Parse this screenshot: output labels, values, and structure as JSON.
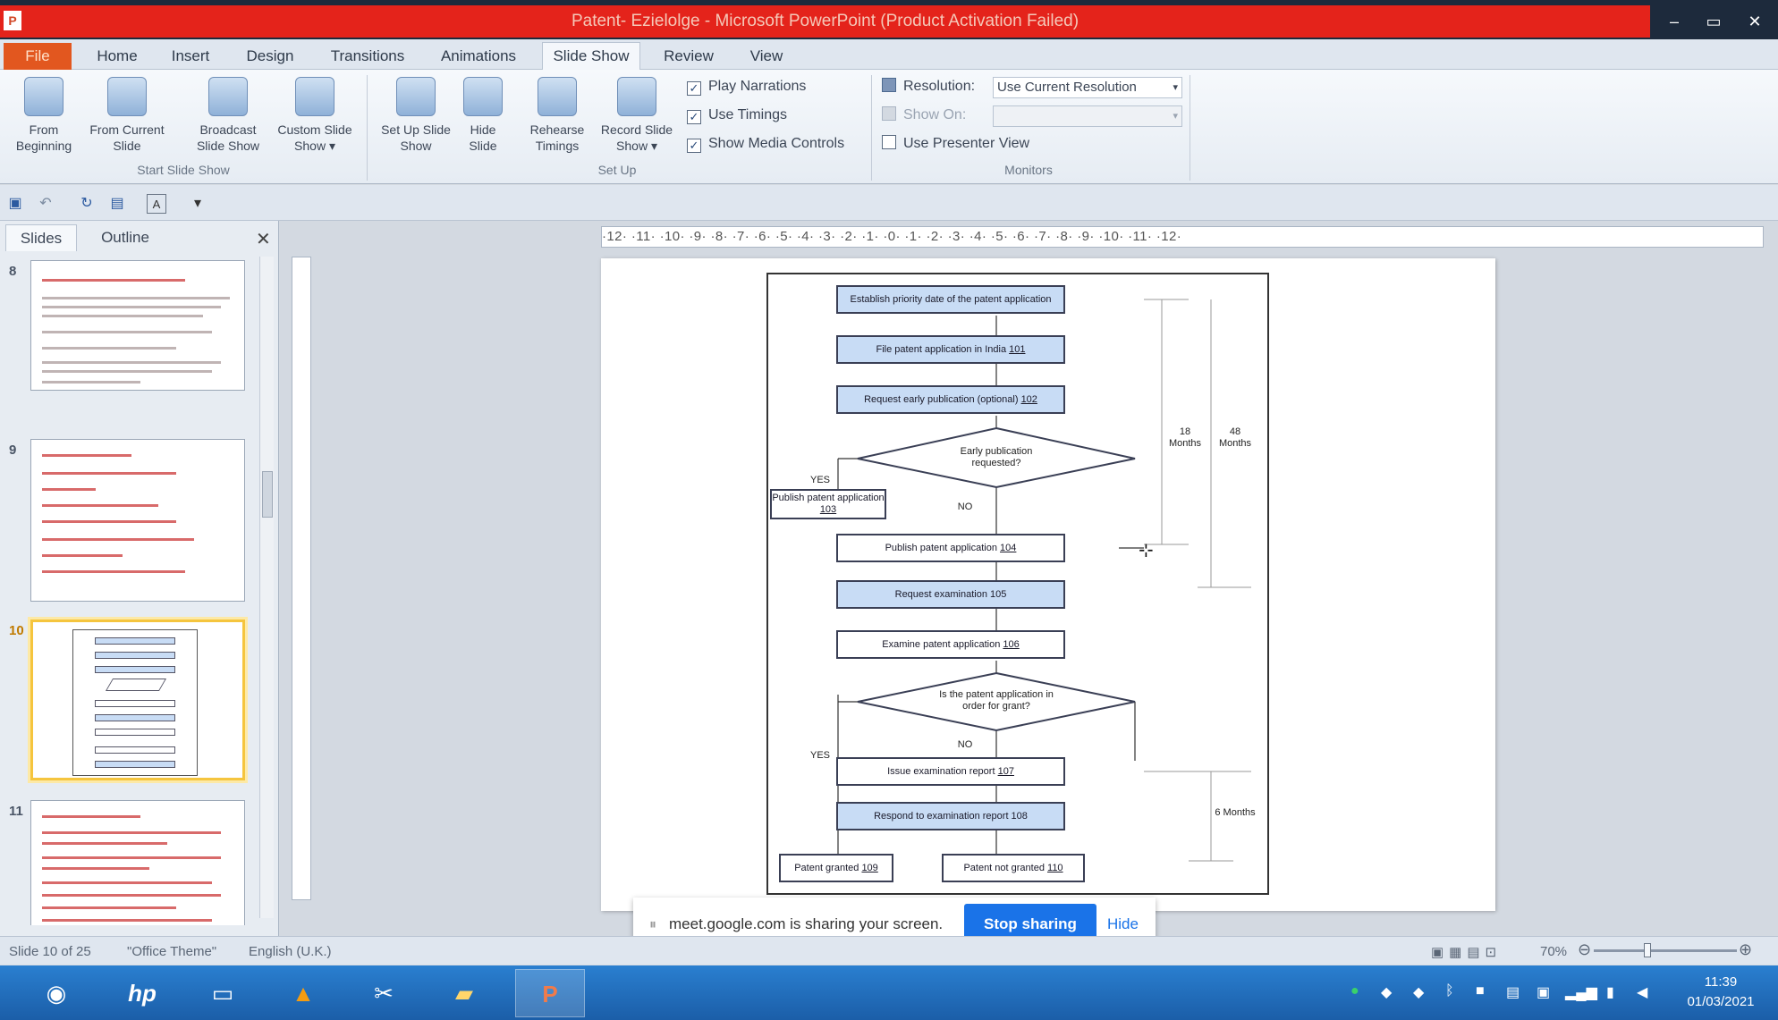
{
  "window": {
    "title": "Patent- Ezielolge - Microsoft PowerPoint (Product Activation Failed)",
    "minimize": "–",
    "maximize": "▭",
    "close": "✕"
  },
  "ribbon_tabs": [
    "File",
    "Home",
    "Insert",
    "Design",
    "Transitions",
    "Animations",
    "Slide Show",
    "Review",
    "View"
  ],
  "ribbon": {
    "start_group": {
      "label": "Start Slide Show",
      "from_beginning": "From Beginning",
      "from_current": "From Current Slide",
      "broadcast": "Broadcast Slide Show",
      "custom": "Custom Slide Show ▾"
    },
    "setup_group": {
      "label": "Set Up",
      "setup_show": "Set Up Slide Show",
      "hide_slide": "Hide Slide",
      "rehearse": "Rehearse Timings",
      "record": "Record Slide Show ▾",
      "play_narrations": "Play Narrations",
      "use_timings": "Use Timings",
      "show_media_controls": "Show Media Controls"
    },
    "monitors_group": {
      "label": "Monitors",
      "resolution_label": "Resolution:",
      "resolution_value": "Use Current Resolution",
      "show_on_label": "Show On:",
      "use_presenter_view": "Use Presenter View"
    }
  },
  "left_panel": {
    "tab_slides": "Slides",
    "tab_outline": "Outline",
    "close": "✕",
    "slide_numbers": [
      "8",
      "9",
      "10",
      "11"
    ]
  },
  "ruler_text": "·12· ·11· ·10· ·9· ·8· ·7· ·6· ·5· ·4· ·3· ·2· ·1· ·0· ·1· ·2· ·3· ·4· ·5· ·6· ·7· ·8· ·9· ·10· ·11· ·12·",
  "flowchart": {
    "box1": "Establish priority date of the patent application",
    "box2": "File patent application in India ",
    "box2_ref": "101",
    "box3": "Request early publication (optional) ",
    "box3_ref": "102",
    "diamond1": "Early publication requested?",
    "yes1": "YES",
    "no1": "NO",
    "box_publish_left": "Publish patent application ",
    "box_publish_left_ref": "103",
    "box4": "Publish patent application ",
    "box4_ref": "104",
    "box5": "Request examination 105",
    "box6": "Examine patent application ",
    "box6_ref": "106",
    "diamond2": "Is the patent application in order for grant?",
    "yes2": "YES",
    "no2": "NO",
    "box7": "Issue examination report ",
    "box7_ref": "107",
    "box8": "Respond to examination report 108",
    "box9": "Patent granted ",
    "box9_ref": "109",
    "box10": "Patent not granted ",
    "box10_ref": "110",
    "bracket1": "18 Months",
    "bracket2": "48 Months",
    "bracket3": "6 Months"
  },
  "share_bar": {
    "message": "meet.google.com is sharing your screen.",
    "stop": "Stop sharing",
    "hide": "Hide"
  },
  "status": {
    "slide_info": "Slide 10 of 25",
    "theme": "\"Office Theme\"",
    "language": "English (U.K.)",
    "zoom": "70%"
  },
  "taskbar": {
    "time": "11:39",
    "date": "01/03/2021"
  },
  "colors": {
    "title_red": "#e4231b",
    "file_tab": "#e2571f",
    "flow_fill": "#c8dcf5",
    "share_blue": "#1a73e8",
    "selected_thumb": "#f5c53e"
  }
}
